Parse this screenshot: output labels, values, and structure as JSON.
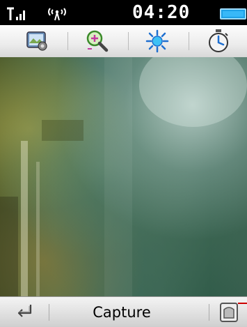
{
  "status_bar": {
    "time": "04:20",
    "signal_icon": "signal-strength-icon",
    "radio_icon": "antenna-icon",
    "battery_icon": "battery-icon"
  },
  "toolbar": {
    "items": [
      {
        "name": "camera-settings-button",
        "icon": "camera-settings-icon"
      },
      {
        "name": "zoom-button",
        "icon": "zoom-icon"
      },
      {
        "name": "brightness-button",
        "icon": "brightness-icon"
      },
      {
        "name": "timer-button",
        "icon": "timer-icon"
      }
    ]
  },
  "bottom_bar": {
    "back_icon": "back-arrow-icon",
    "capture_label": "Capture",
    "gallery_icon": "gallery-icon"
  },
  "colors": {
    "toolbar_bg": "#ececec",
    "status_bg": "#000000",
    "accent_blue": "#1ea0e6"
  }
}
